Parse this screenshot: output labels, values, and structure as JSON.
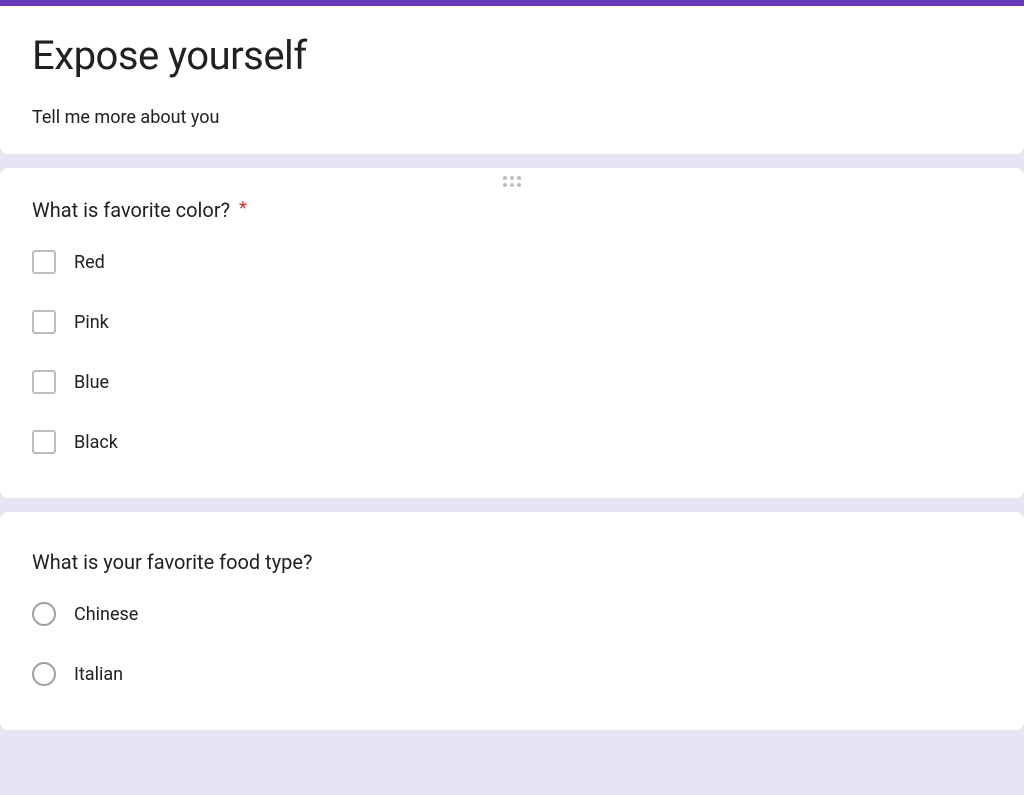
{
  "header": {
    "title": "Expose yourself",
    "description": "Tell me more about you"
  },
  "questions": [
    {
      "title": "What is favorite color?",
      "required": true,
      "type": "checkbox",
      "options": [
        "Red",
        "Pink",
        "Blue",
        "Black"
      ]
    },
    {
      "title": "What is your favorite food type?",
      "required": false,
      "type": "radio",
      "options": [
        "Chinese",
        "Italian"
      ]
    }
  ],
  "colors": {
    "accent": "#673ab7",
    "required": "#d93025"
  }
}
